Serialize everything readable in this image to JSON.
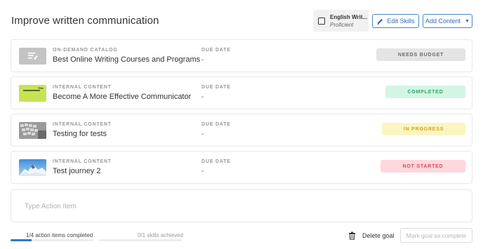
{
  "goal": {
    "title": "Improve written communication"
  },
  "skill": {
    "name": "English Writ...",
    "level": "Proficient"
  },
  "buttons": {
    "edit_skills": "Edit Skills",
    "add_content": "Add Content"
  },
  "items": [
    {
      "kind": "ON-DEMAND CATALOG",
      "title": "Best Online Writing Courses and Programs",
      "due_label": "DUE DATE",
      "due_value": "-",
      "status": "NEEDS BUDGET",
      "status_bg": "#e4e4e4",
      "status_color": "#6b6b6b",
      "thumb": "catalog-icon"
    },
    {
      "kind": "INTERNAL CONTENT",
      "title": "Become A More Effective Communicator",
      "due_label": "DUE DATE",
      "due_value": "-",
      "status": "COMPLETED",
      "status_bg": "#d3f6e4",
      "status_color": "#2fa56a",
      "thumb": "lime-banner",
      "thumb_text": "Title"
    },
    {
      "kind": "INTERNAL CONTENT",
      "title": "Testing for tests",
      "due_label": "DUE DATE",
      "due_value": "-",
      "status": "IN PROGRESS",
      "status_bg": "#fbf5c2",
      "status_color": "#d4a21b",
      "thumb": "keyboard-photo"
    },
    {
      "kind": "INTERNAL CONTENT",
      "title": "Test journey 2",
      "due_label": "DUE DATE",
      "due_value": "-",
      "status": "NOT STARTED",
      "status_bg": "#ffd7dc",
      "status_color": "#d84a5c",
      "thumb": "mountain-photo"
    }
  ],
  "action_input": {
    "placeholder": "Type Action Item"
  },
  "progress": {
    "actions_label": "1/4 action items completed",
    "actions_fraction": 0.25,
    "skills_label": "0/1 skills achieved",
    "skills_fraction": 0
  },
  "footer": {
    "delete_goal": "Delete goal",
    "mark_complete": "Mark goal as complete"
  },
  "colors": {
    "accent": "#2e6db4",
    "progress": "#2b78d0"
  }
}
